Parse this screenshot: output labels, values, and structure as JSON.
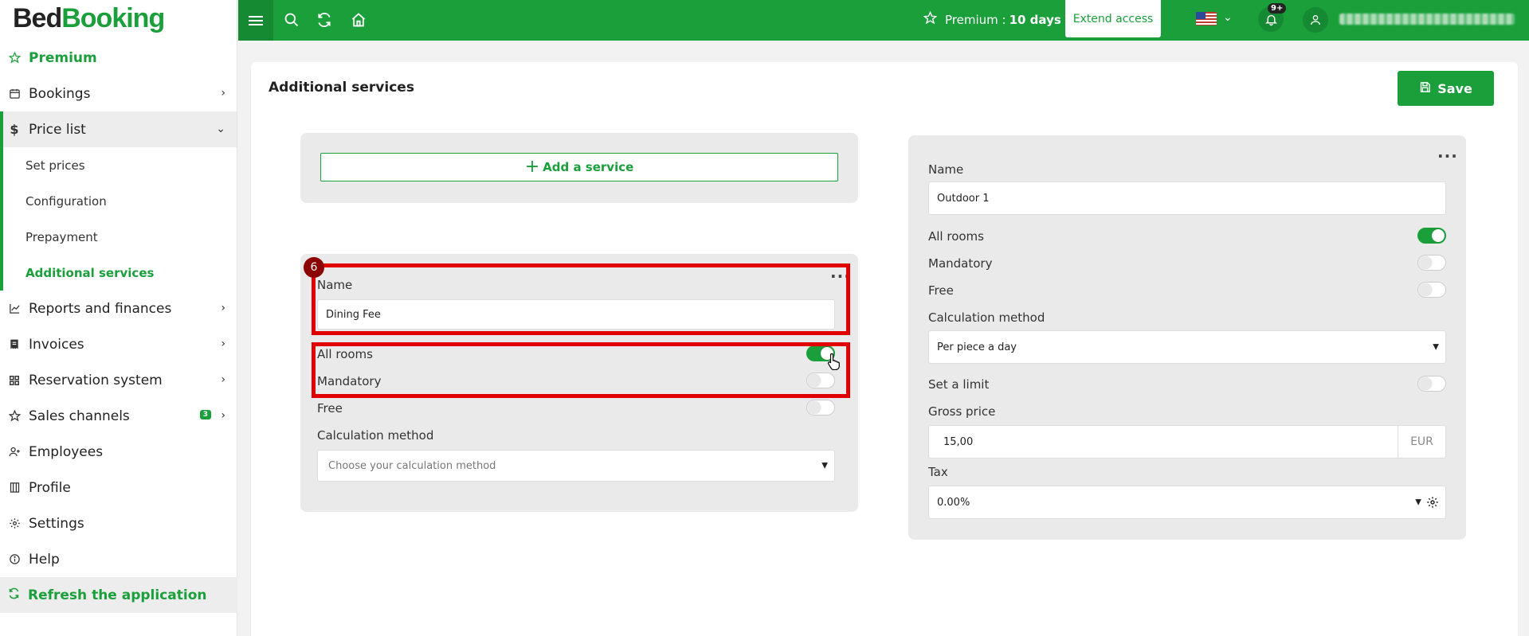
{
  "logo": {
    "part1": "Bed",
    "part2": "Booking"
  },
  "sidebar": {
    "premium": "Premium",
    "items": [
      {
        "label": "Bookings",
        "icon": "calendar-icon"
      },
      {
        "label": "Price list",
        "icon": "dollar-icon"
      },
      {
        "label": "Reports and finances",
        "icon": "chart-icon"
      },
      {
        "label": "Invoices",
        "icon": "invoice-icon"
      },
      {
        "label": "Reservation system",
        "icon": "grid-icon"
      },
      {
        "label": "Sales channels",
        "icon": "star-icon",
        "badge": "3"
      },
      {
        "label": "Employees",
        "icon": "user-plus-icon"
      },
      {
        "label": "Profile",
        "icon": "building-icon"
      },
      {
        "label": "Settings",
        "icon": "gear-icon"
      },
      {
        "label": "Help",
        "icon": "info-icon"
      }
    ],
    "price_list_sub": [
      "Set prices",
      "Configuration",
      "Prepayment",
      "Additional services"
    ],
    "refresh": "Refresh the application"
  },
  "topbar": {
    "premium_label": "Premium :",
    "premium_days": "10 days",
    "extend": "Extend access",
    "notif_badge": "9+"
  },
  "page": {
    "title": "Additional services",
    "save": "Save"
  },
  "left": {
    "add_service": "Add a service",
    "step": "6",
    "name_label": "Name",
    "name_value": "Dining Fee",
    "all_rooms": "All rooms",
    "mandatory": "Mandatory",
    "free": "Free",
    "calc_label": "Calculation method",
    "calc_placeholder": "Choose your calculation method",
    "toggles": {
      "all_rooms": true,
      "mandatory": false,
      "free": false
    }
  },
  "right": {
    "name_label": "Name",
    "name_value": "Outdoor 1",
    "all_rooms": "All rooms",
    "mandatory": "Mandatory",
    "free": "Free",
    "calc_label": "Calculation method",
    "calc_value": "Per piece a day",
    "set_limit": "Set a limit",
    "gross_label": "Gross price",
    "gross_value": "15,00",
    "currency": "EUR",
    "tax_label": "Tax",
    "tax_value": "0.00%",
    "toggles": {
      "all_rooms": true,
      "mandatory": false,
      "free": false,
      "set_limit": false
    }
  },
  "colors": {
    "brand": "#1a9f3b",
    "highlight": "#e00000"
  }
}
